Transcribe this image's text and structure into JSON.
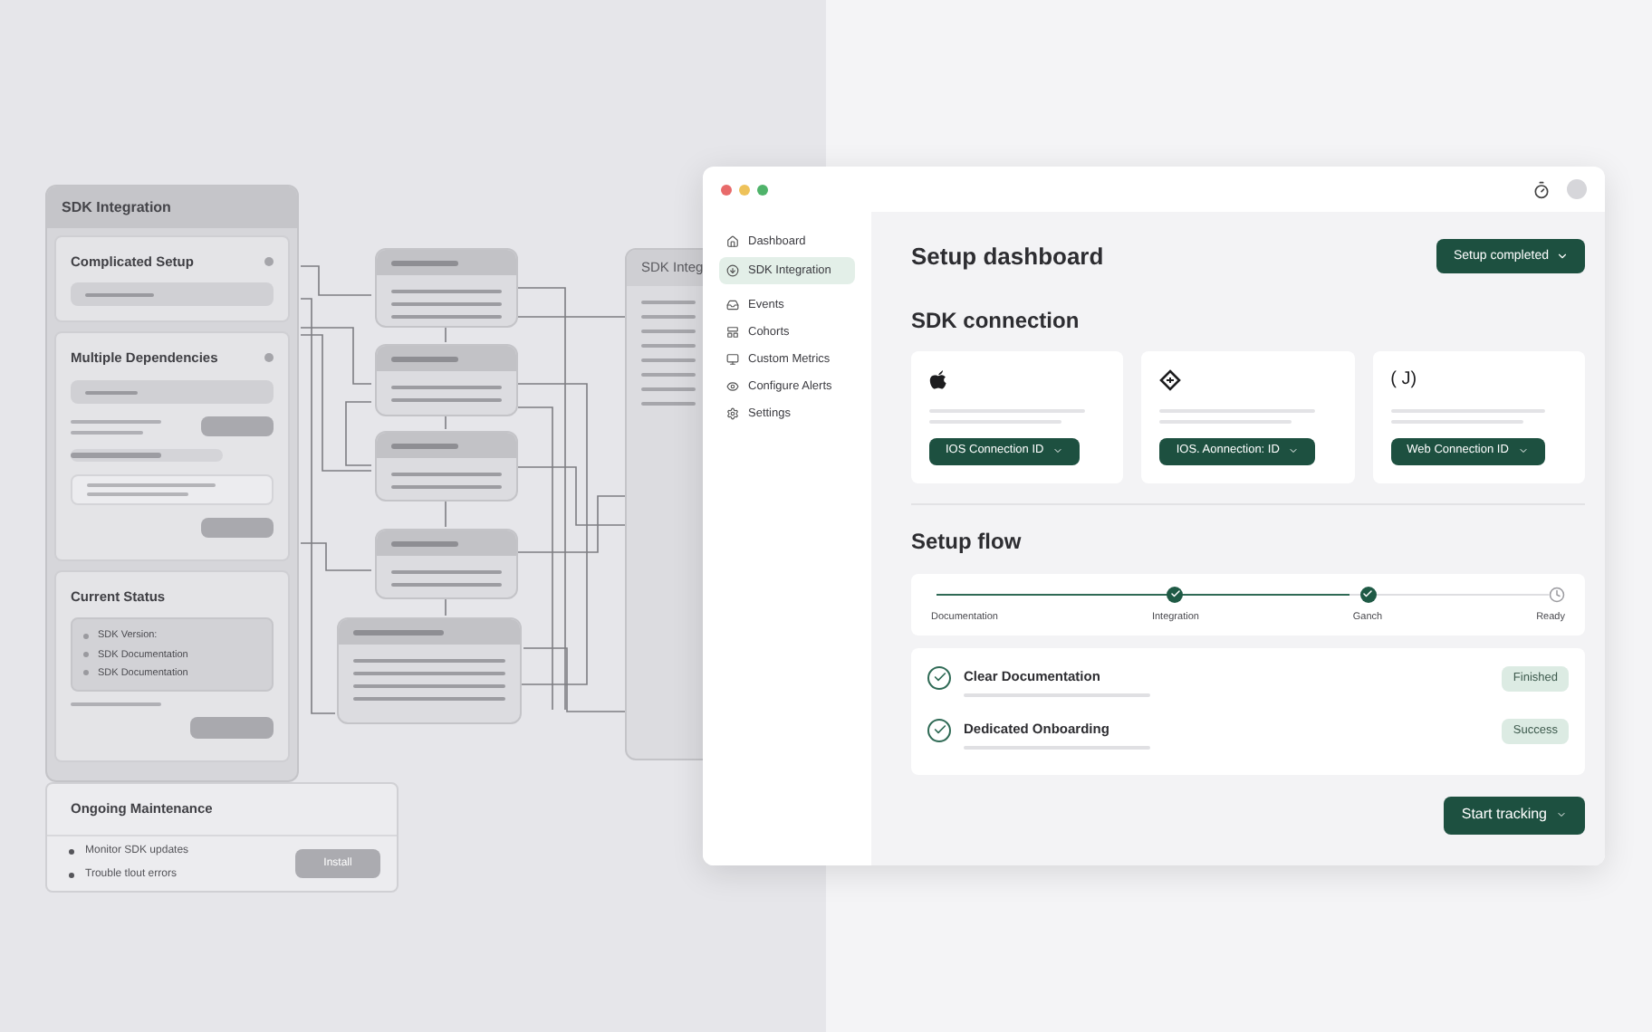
{
  "wireframe": {
    "panel": {
      "title": "SDK Integration",
      "sections": [
        {
          "title": "Complicated Setup"
        },
        {
          "title": "Multiple Dependencies"
        },
        {
          "title": "Current Status",
          "items": [
            "SDK Version:",
            "SDK Documentation",
            "SDK Documentation"
          ]
        }
      ]
    },
    "maintenance": {
      "title": "Ongoing Maintenance",
      "items": [
        "Monitor SDK updates",
        "Trouble tlout errors"
      ],
      "button": "Install"
    },
    "side_panel": {
      "title": "SDK Integ"
    }
  },
  "window": {
    "sidebar": [
      {
        "label": "Dashboard",
        "selected": false
      },
      {
        "label": "SDK Integration",
        "selected": true
      },
      {
        "label": "Events",
        "selected": false
      },
      {
        "label": "Cohorts",
        "selected": false
      },
      {
        "label": "Custom Metrics",
        "selected": false
      },
      {
        "label": "Configure Alerts",
        "selected": false
      },
      {
        "label": "Settings",
        "selected": false
      }
    ],
    "title": "Setup dashboard",
    "status_button": "Setup completed",
    "sdk_title": "SDK connection",
    "connections": [
      {
        "kind": "apple",
        "button": "IOS Connection ID"
      },
      {
        "kind": "diamond",
        "button": "IOS. Aonnection: ID"
      },
      {
        "kind": "glyph",
        "glyph": "( J)",
        "button": "Web Connection ID"
      }
    ],
    "flow_title": "Setup flow",
    "steps": [
      {
        "label": "Documentation",
        "kind": "start",
        "done": true
      },
      {
        "label": "Integration",
        "kind": "step",
        "done": true
      },
      {
        "label": "Ganch",
        "kind": "step",
        "done": true
      },
      {
        "label": "Ready",
        "kind": "end",
        "done": false
      }
    ],
    "tasks": [
      {
        "title": "Clear Documentation",
        "badge": "Finished",
        "checked": true
      },
      {
        "title": "Dedicated Onboarding",
        "badge": "Success",
        "checked": true
      }
    ],
    "action": "Start tracking"
  }
}
